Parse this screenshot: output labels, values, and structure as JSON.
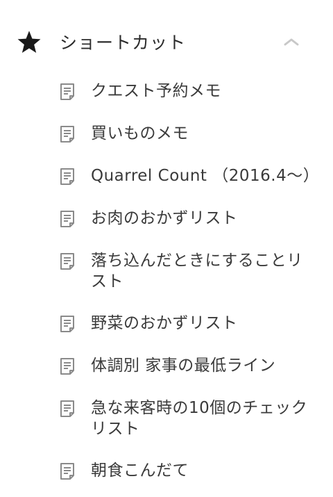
{
  "section": {
    "title": "ショートカット",
    "icon": "star-icon",
    "collapse_icon": "chevron-up-icon",
    "accent_color": "#1a1a1a"
  },
  "items": [
    {
      "label": "クエスト予約メモ",
      "icon": "note-icon"
    },
    {
      "label": "買いものメモ",
      "icon": "note-icon"
    },
    {
      "label": "Quarrel Count （2016.4〜）",
      "icon": "note-icon"
    },
    {
      "label": "お肉のおかずリスト",
      "icon": "note-icon"
    },
    {
      "label": "落ち込んだときにすることリスト",
      "icon": "note-icon"
    },
    {
      "label": "野菜のおかずリスト",
      "icon": "note-icon"
    },
    {
      "label": "体調別 家事の最低ライン",
      "icon": "note-icon"
    },
    {
      "label": "急な来客時の10個のチェックリスト",
      "icon": "note-icon"
    },
    {
      "label": "朝食こんだて",
      "icon": "note-icon"
    }
  ]
}
